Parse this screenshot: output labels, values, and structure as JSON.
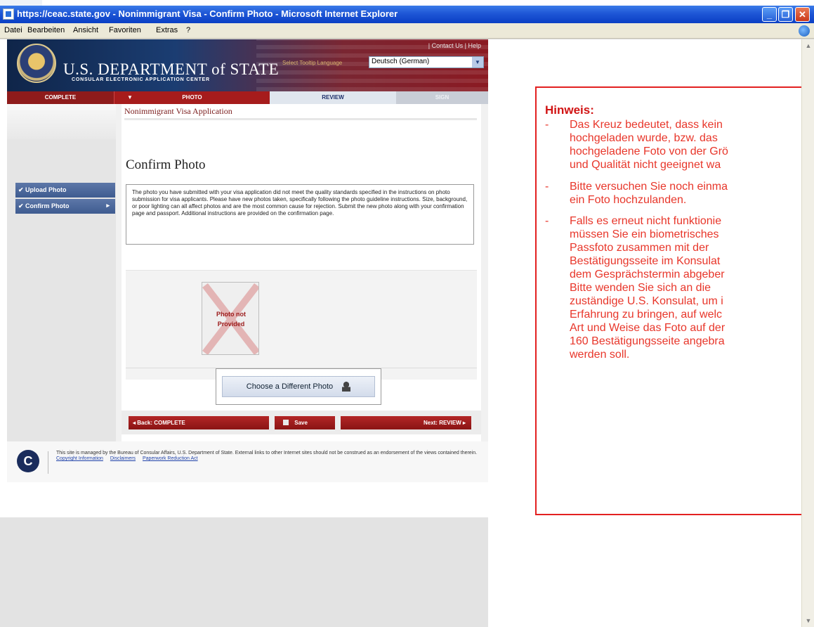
{
  "window": {
    "title": "https://ceac.state.gov - Nonimmigrant Visa - Confirm Photo - Microsoft Internet Explorer",
    "btn_min": "_",
    "btn_max": "❐",
    "btn_close": "✕"
  },
  "menu": [
    "Datei",
    "Bearbeiten",
    "Ansicht",
    "Favoriten",
    "Extras",
    "?"
  ],
  "site": {
    "top_links": "|  Contact Us  |  Help",
    "dept_name": "U.S. DEPARTMENT of STATE",
    "ceac_name": "CONSULAR ELECTRONIC APPLICATION CENTER",
    "language_label": "Select Tooltip Language",
    "language_value": "Deutsch (German)"
  },
  "steps": {
    "complete": "COMPLETE",
    "photo": "PHOTO",
    "photo_arrow": "▼",
    "review": "REVIEW",
    "sign": "SIGN"
  },
  "sidebar": {
    "upload": "✔ Upload Photo",
    "confirm": "✔ Confirm Photo",
    "confirm_chevron": "▸"
  },
  "main": {
    "breadcrumb": "Nonimmigrant Visa Application",
    "title": "Confirm Photo",
    "info": "The photo you have submitted with your visa application did not meet the quality standards specified in the instructions on photo submission for visa applicants. Please have new photos taken, specifically following the photo guideline instructions. Size, background, or poor lighting can all affect photos and are the most common cause for rejection. Submit the new photo along with your confirmation page and passport. Additional instructions are provided on the confirmation page.",
    "photo_not": "Photo not",
    "photo_provided": "Provided",
    "choose_label": "Choose a Different Photo",
    "back_label": "◂ Back: COMPLETE",
    "save_label": "Save",
    "next_label": "Next: REVIEW ▸"
  },
  "footer": {
    "text": "This site is managed by the Bureau of Consular Affairs, U.S. Department of State. External links to other Internet sites should not be construed as an endorsement of the views contained therein.",
    "links": [
      "Copyright Information",
      "Disclaimers",
      "Paperwork Reduction Act"
    ],
    "logo_letter": "C"
  },
  "note": {
    "title": "Hinweis:",
    "dash": "-",
    "items": [
      "Das Kreuz bedeutet, dass kein\nhochgeladen wurde, bzw. das\nhochgeladene Foto von der Grö\nund Qualität nicht geeignet wa",
      "Bitte versuchen Sie noch einma\nein Foto hochzulanden.",
      "Falls es erneut nicht funktionie\nmüssen Sie ein biometrisches\nPassfoto zusammen mit der\nBestätigungsseite im Konsulat\ndem Gesprächstermin abgeber\nBitte wenden Sie sich an die\nzuständige U.S. Konsulat, um i\nErfahrung zu bringen, auf welc\nArt und Weise das Foto auf der\n160 Bestätigungsseite angebra\nwerden soll."
    ]
  }
}
